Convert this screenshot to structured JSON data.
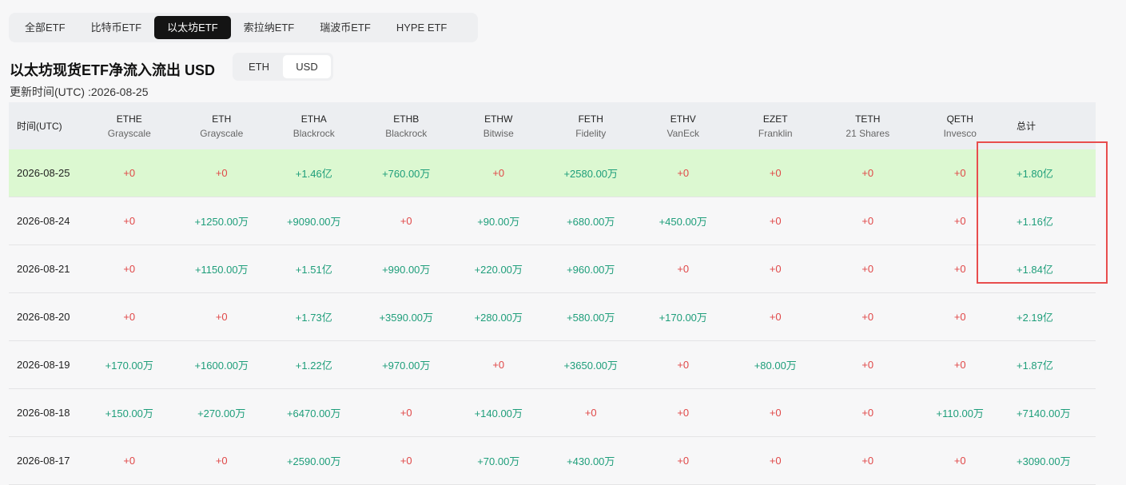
{
  "tabs": [
    "全部ETF",
    "比特币ETF",
    "以太坊ETF",
    "索拉纳ETF",
    "瑞波币ETF",
    "HYPE ETF"
  ],
  "active_tab": 2,
  "title": "以太坊现货ETF净流入流出 USD",
  "unit_toggle": {
    "options": [
      "ETH",
      "USD"
    ],
    "selected": "USD"
  },
  "updated": "更新时间(UTC) :2026-08-25",
  "table": {
    "date_header": "时间(UTC)",
    "total_header": "总计",
    "columns": [
      {
        "ticker": "ETHE",
        "issuer": "Grayscale"
      },
      {
        "ticker": "ETH",
        "issuer": "Grayscale"
      },
      {
        "ticker": "ETHA",
        "issuer": "Blackrock"
      },
      {
        "ticker": "ETHB",
        "issuer": "Blackrock"
      },
      {
        "ticker": "ETHW",
        "issuer": "Bitwise"
      },
      {
        "ticker": "FETH",
        "issuer": "Fidelity"
      },
      {
        "ticker": "ETHV",
        "issuer": "VanEck"
      },
      {
        "ticker": "EZET",
        "issuer": "Franklin"
      },
      {
        "ticker": "TETH",
        "issuer": "21 Shares"
      },
      {
        "ticker": "QETH",
        "issuer": "Invesco"
      }
    ],
    "rows": [
      {
        "date": "2026-08-25",
        "values": [
          "+0",
          "+0",
          "+1.46亿",
          "+760.00万",
          "+0",
          "+2580.00万",
          "+0",
          "+0",
          "+0",
          "+0"
        ],
        "total": "+1.80亿",
        "highlight": true
      },
      {
        "date": "2026-08-24",
        "values": [
          "+0",
          "+1250.00万",
          "+9090.00万",
          "+0",
          "+90.00万",
          "+680.00万",
          "+450.00万",
          "+0",
          "+0",
          "+0"
        ],
        "total": "+1.16亿"
      },
      {
        "date": "2026-08-21",
        "values": [
          "+0",
          "+1150.00万",
          "+1.51亿",
          "+990.00万",
          "+220.00万",
          "+960.00万",
          "+0",
          "+0",
          "+0",
          "+0"
        ],
        "total": "+1.84亿"
      },
      {
        "date": "2026-08-20",
        "values": [
          "+0",
          "+0",
          "+1.73亿",
          "+3590.00万",
          "+280.00万",
          "+580.00万",
          "+170.00万",
          "+0",
          "+0",
          "+0"
        ],
        "total": "+2.19亿"
      },
      {
        "date": "2026-08-19",
        "values": [
          "+170.00万",
          "+1600.00万",
          "+1.22亿",
          "+970.00万",
          "+0",
          "+3650.00万",
          "+0",
          "+80.00万",
          "+0",
          "+0"
        ],
        "total": "+1.87亿"
      },
      {
        "date": "2026-08-18",
        "values": [
          "+150.00万",
          "+270.00万",
          "+6470.00万",
          "+0",
          "+140.00万",
          "+0",
          "+0",
          "+0",
          "+0",
          "+110.00万"
        ],
        "total": "+7140.00万"
      },
      {
        "date": "2026-08-17",
        "values": [
          "+0",
          "+0",
          "+2590.00万",
          "+0",
          "+70.00万",
          "+430.00万",
          "+0",
          "+0",
          "+0",
          "+0"
        ],
        "total": "+3090.00万"
      }
    ]
  },
  "colors": {
    "positive": "#1e9e7a",
    "zero": "#e04848",
    "highlight_row": "#dcf8d1",
    "annotation_box": "#e84d4d"
  }
}
